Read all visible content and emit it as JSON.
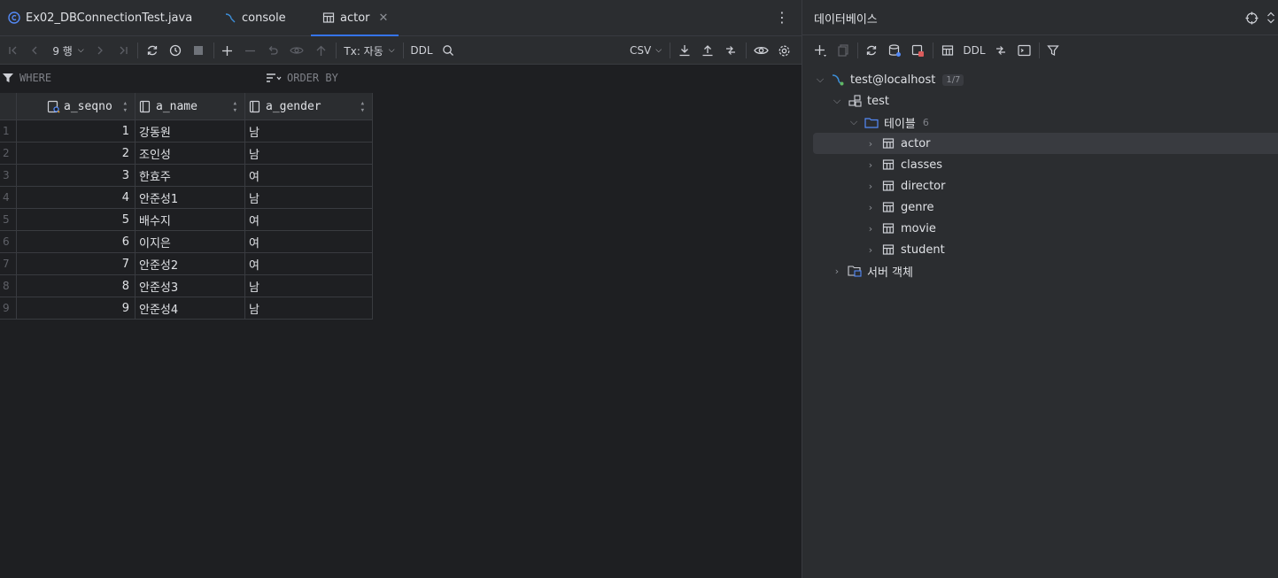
{
  "tabs": [
    {
      "label": "Ex02_DBConnectionTest.java",
      "icon": "java-class-icon"
    },
    {
      "label": "console",
      "icon": "console-icon"
    },
    {
      "label": "actor",
      "icon": "table-icon",
      "active": true
    }
  ],
  "toolbar": {
    "rows_label": "9 행",
    "tx_label": "Tx: 자동",
    "ddl_label": "DDL",
    "csv_label": "CSV"
  },
  "filter": {
    "where_label": "WHERE",
    "orderby_label": "ORDER BY"
  },
  "grid": {
    "columns": [
      "a_seqno",
      "a_name",
      "a_gender"
    ],
    "rows": [
      {
        "n": "1",
        "seqno": "1",
        "name": "강동원",
        "gender": "남"
      },
      {
        "n": "2",
        "seqno": "2",
        "name": "조인성",
        "gender": "남"
      },
      {
        "n": "3",
        "seqno": "3",
        "name": "한효주",
        "gender": "여"
      },
      {
        "n": "4",
        "seqno": "4",
        "name": "안준성1",
        "gender": "남"
      },
      {
        "n": "5",
        "seqno": "5",
        "name": "배수지",
        "gender": "여"
      },
      {
        "n": "6",
        "seqno": "6",
        "name": "이지은",
        "gender": "여"
      },
      {
        "n": "7",
        "seqno": "7",
        "name": "안준성2",
        "gender": "여"
      },
      {
        "n": "8",
        "seqno": "8",
        "name": "안준성3",
        "gender": "남"
      },
      {
        "n": "9",
        "seqno": "9",
        "name": "안준성4",
        "gender": "남"
      }
    ]
  },
  "db_panel": {
    "title": "데이터베이스",
    "toolbar_ddl": "DDL",
    "connection": {
      "label": "test@localhost",
      "badge": "1/7"
    },
    "schema": "test",
    "tables_folder": {
      "label": "테이블",
      "count": "6"
    },
    "tables": [
      "actor",
      "classes",
      "director",
      "genre",
      "movie",
      "student"
    ],
    "server_objects": "서버 객체"
  },
  "colors": {
    "accent": "#3574f0",
    "background": "#1e1f22",
    "panel": "#2b2d30"
  }
}
